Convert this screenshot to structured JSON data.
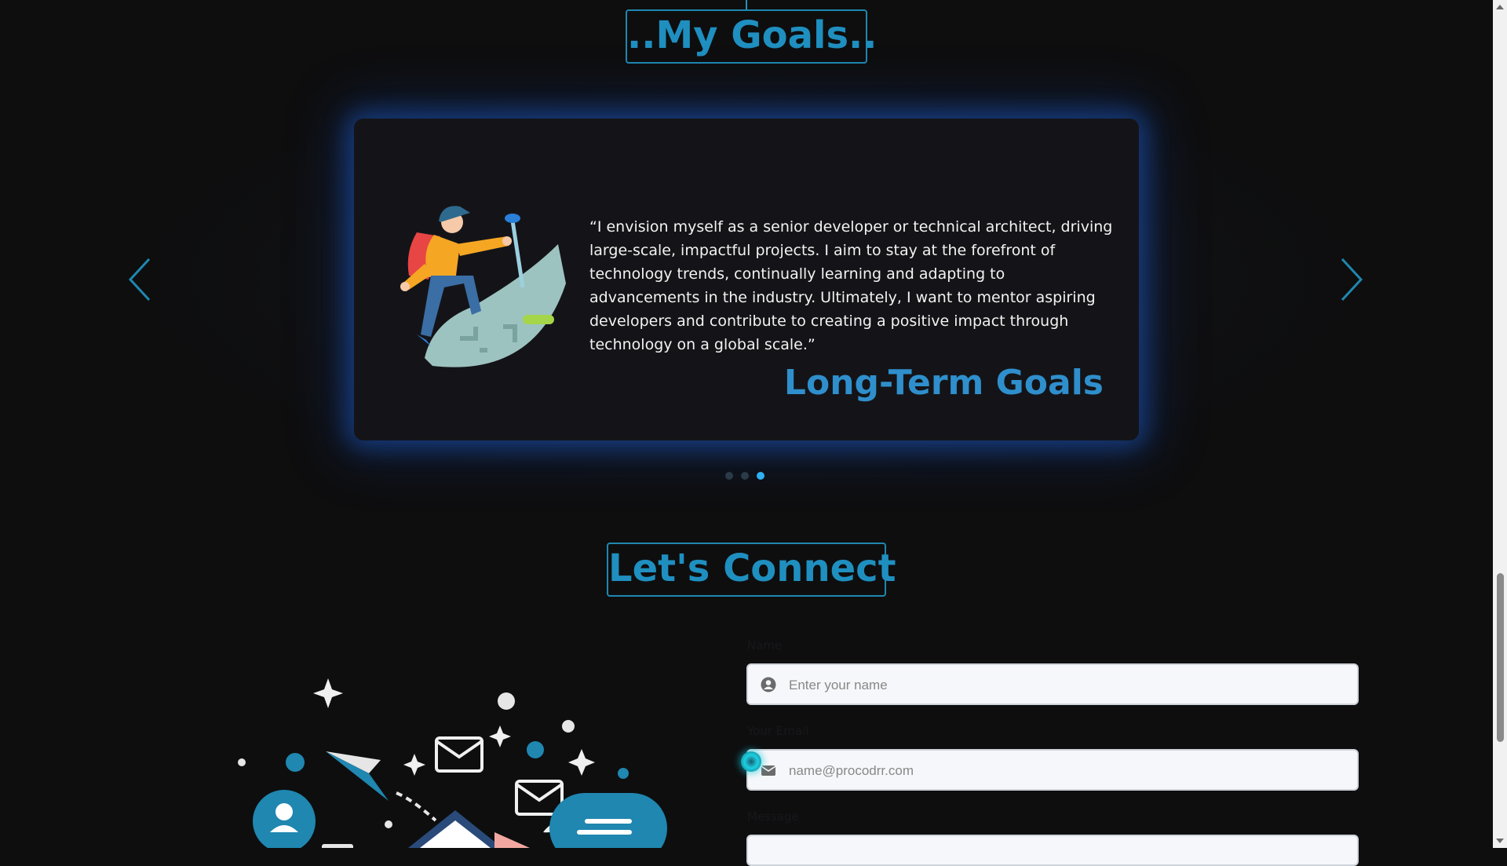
{
  "goals": {
    "title": "..My Goals..",
    "card": {
      "quote": "“I envision myself as a senior developer or technical architect, driving large-scale, impactful projects. I aim to stay at the forefront of technology trends, continually learning and adapting to advancements in the industry. Ultimately, I want to mentor aspiring developers and contribute to creating a positive impact through technology on a global scale.”",
      "heading": "Long-Term Goals"
    },
    "slide_count": 3,
    "active_slide": 3
  },
  "connect": {
    "title": "Let's Connect",
    "form": {
      "name_label": "Name",
      "name_placeholder": "Enter your name",
      "email_label": "Your Email",
      "email_placeholder": "name@procodrr.com",
      "message_label": "Message"
    }
  },
  "colors": {
    "accent": "#1f87b0",
    "card_glow": "#1e64dc",
    "active_dot": "#2fb0f0",
    "background": "#0e0e0f"
  },
  "icons": [
    "chevron-left-icon",
    "chevron-right-icon",
    "user-circle-icon",
    "envelope-icon"
  ]
}
